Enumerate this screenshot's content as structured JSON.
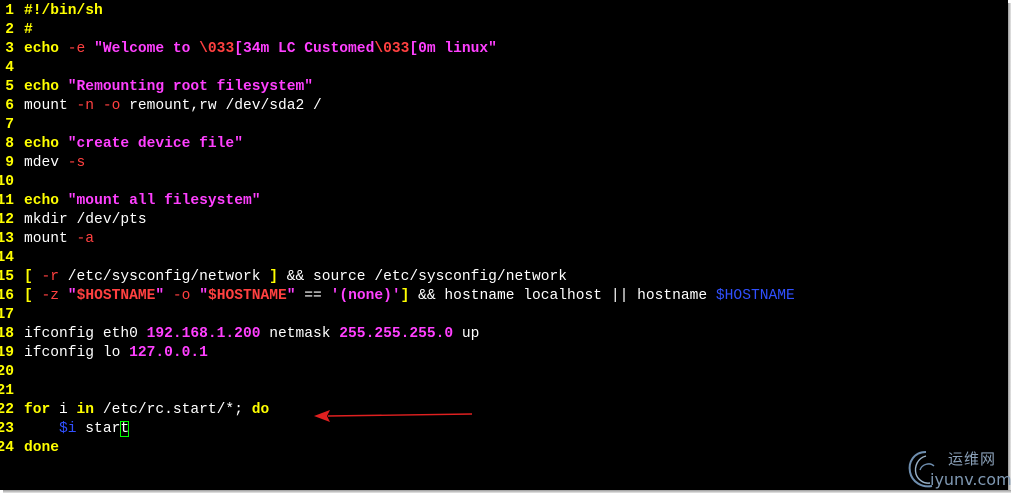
{
  "lines": [
    {
      "n": "1",
      "parts": [
        {
          "t": "#!/bin/sh",
          "c": "kw"
        }
      ]
    },
    {
      "n": "2",
      "parts": [
        {
          "t": "#",
          "c": "kw"
        }
      ]
    },
    {
      "n": "3",
      "parts": [
        {
          "t": "echo ",
          "c": "kw"
        },
        {
          "t": "-e ",
          "c": "opt"
        },
        {
          "t": "\"Welcome to ",
          "c": "str"
        },
        {
          "t": "\\033",
          "c": "esc"
        },
        {
          "t": "[34m LC Customed",
          "c": "str"
        },
        {
          "t": "\\033",
          "c": "esc"
        },
        {
          "t": "[0m linux\"",
          "c": "str"
        }
      ]
    },
    {
      "n": "4",
      "parts": []
    },
    {
      "n": "5",
      "parts": [
        {
          "t": "echo ",
          "c": "kw"
        },
        {
          "t": "\"Remounting root filesystem\"",
          "c": "str"
        }
      ]
    },
    {
      "n": "6",
      "parts": [
        {
          "t": "mount ",
          "c": "plain"
        },
        {
          "t": "-n ",
          "c": "opt"
        },
        {
          "t": "-o ",
          "c": "opt"
        },
        {
          "t": "remount,rw /dev/sda2 /",
          "c": "plain"
        }
      ]
    },
    {
      "n": "7",
      "parts": []
    },
    {
      "n": "8",
      "parts": [
        {
          "t": "echo ",
          "c": "kw"
        },
        {
          "t": "\"create device file\"",
          "c": "str"
        }
      ]
    },
    {
      "n": "9",
      "parts": [
        {
          "t": "mdev ",
          "c": "plain"
        },
        {
          "t": "-s",
          "c": "opt"
        }
      ]
    },
    {
      "n": "10",
      "parts": []
    },
    {
      "n": "11",
      "parts": [
        {
          "t": "echo ",
          "c": "kw"
        },
        {
          "t": "\"mount all filesystem\"",
          "c": "str"
        }
      ]
    },
    {
      "n": "12",
      "parts": [
        {
          "t": "mkdir /dev/pts",
          "c": "plain"
        }
      ]
    },
    {
      "n": "13",
      "parts": [
        {
          "t": "mount ",
          "c": "plain"
        },
        {
          "t": "-a",
          "c": "opt"
        }
      ]
    },
    {
      "n": "14",
      "parts": []
    },
    {
      "n": "15",
      "parts": [
        {
          "t": "[ ",
          "c": "op"
        },
        {
          "t": "-r ",
          "c": "opt"
        },
        {
          "t": "/etc/sysconfig/network ",
          "c": "plain"
        },
        {
          "t": "] ",
          "c": "op"
        },
        {
          "t": "&& source /etc/sysconfig/network",
          "c": "plain"
        }
      ]
    },
    {
      "n": "16",
      "parts": [
        {
          "t": "[ ",
          "c": "op"
        },
        {
          "t": "-z ",
          "c": "opt"
        },
        {
          "t": "\"",
          "c": "str"
        },
        {
          "t": "$HOSTNAME",
          "c": "esc"
        },
        {
          "t": "\" ",
          "c": "str"
        },
        {
          "t": "-o ",
          "c": "opt"
        },
        {
          "t": "\"",
          "c": "str"
        },
        {
          "t": "$HOSTNAME",
          "c": "esc"
        },
        {
          "t": "\" ",
          "c": "str"
        },
        {
          "t": "== ",
          "c": "plain"
        },
        {
          "t": "'(none)'",
          "c": "str"
        },
        {
          "t": "] ",
          "c": "op"
        },
        {
          "t": "&& hostname localhost || hostname ",
          "c": "plain"
        },
        {
          "t": "$HOSTNAME",
          "c": "var"
        }
      ]
    },
    {
      "n": "17",
      "parts": []
    },
    {
      "n": "18",
      "parts": [
        {
          "t": "ifconfig eth0 ",
          "c": "plain"
        },
        {
          "t": "192.168.1.200",
          "c": "num"
        },
        {
          "t": " netmask ",
          "c": "plain"
        },
        {
          "t": "255.255.255.0",
          "c": "num"
        },
        {
          "t": " up",
          "c": "plain"
        }
      ]
    },
    {
      "n": "19",
      "parts": [
        {
          "t": "ifconfig lo ",
          "c": "plain"
        },
        {
          "t": "127.0.0.1",
          "c": "num"
        }
      ]
    },
    {
      "n": "20",
      "parts": []
    },
    {
      "n": "21",
      "parts": []
    },
    {
      "n": "22",
      "parts": [
        {
          "t": "for ",
          "c": "kw"
        },
        {
          "t": "i ",
          "c": "plain"
        },
        {
          "t": "in ",
          "c": "kw"
        },
        {
          "t": "/etc/rc.start/*; ",
          "c": "plain"
        },
        {
          "t": "do",
          "c": "kw"
        }
      ]
    },
    {
      "n": "23",
      "parts": [
        {
          "t": "    ",
          "c": "plain"
        },
        {
          "t": "$i",
          "c": "var"
        },
        {
          "t": " star",
          "c": "plain"
        },
        {
          "t": "t",
          "c": "plain",
          "cursor": true
        }
      ]
    },
    {
      "n": "24",
      "parts": [
        {
          "t": "done",
          "c": "kw"
        }
      ]
    }
  ],
  "watermark": {
    "cn": "运维网",
    "domain": "iyunv.com"
  },
  "colors": {
    "background": "#000000",
    "line_number": "#ffff00",
    "keyword": "#ffff00",
    "string": "#ff40ff",
    "option": "#ff4040",
    "variable": "#3050ff",
    "cursor": "#00ff00",
    "arrow": "#e02020"
  },
  "icons": {
    "watermark_logo": "swirl-cloud-logo-icon",
    "annotation": "arrow-left-icon"
  }
}
